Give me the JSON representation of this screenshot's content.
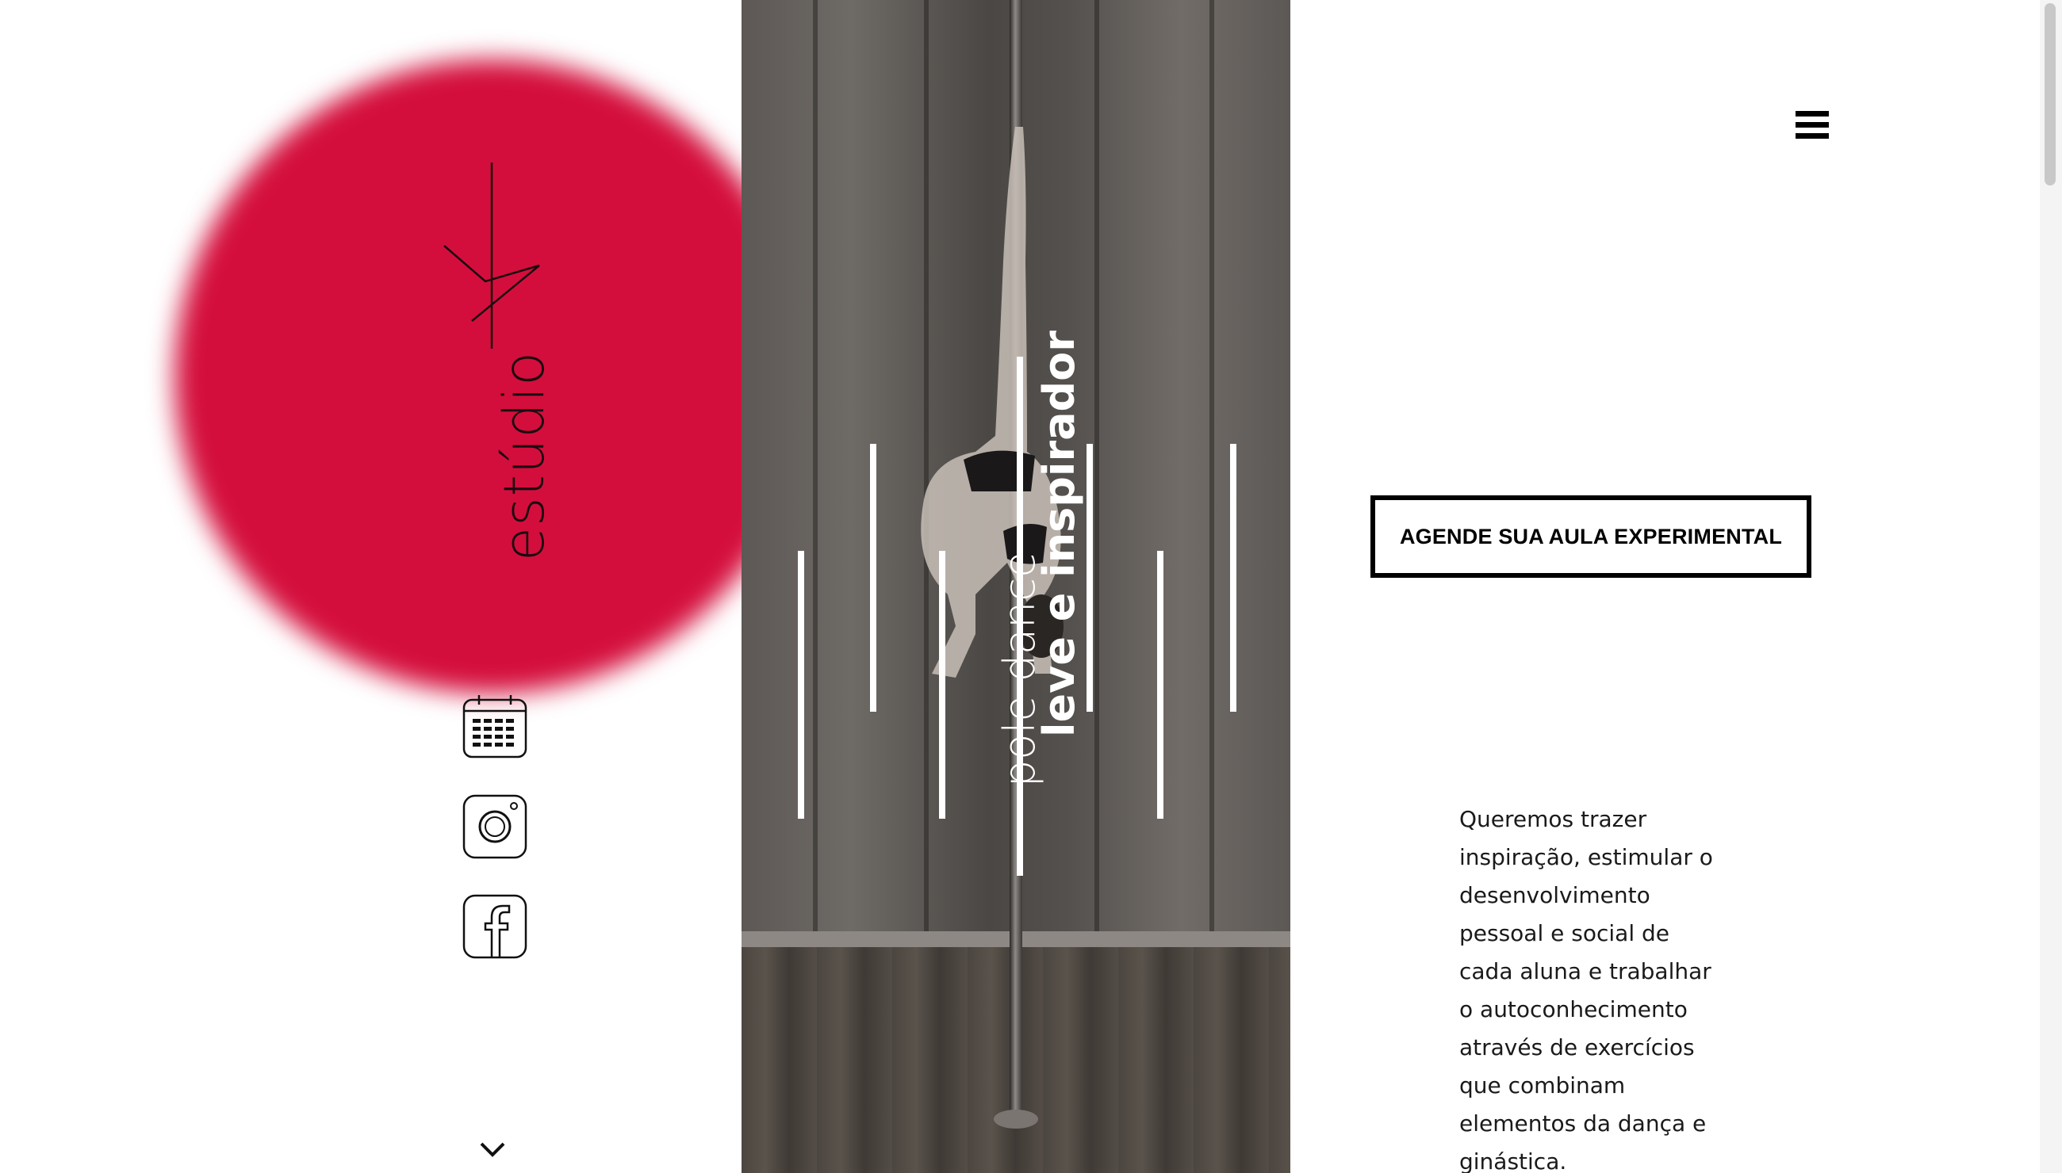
{
  "brand": {
    "logo_text": "estúdio",
    "accent_color": "#d40e3c"
  },
  "hero": {
    "tagline_light": "pole dance",
    "tagline_bold": "leve e inspirador"
  },
  "side_icons": [
    {
      "name": "calendar-icon"
    },
    {
      "name": "instagram-icon"
    },
    {
      "name": "facebook-icon"
    }
  ],
  "nav": {
    "menu_icon": "hamburger-menu-icon"
  },
  "cta": {
    "label": "AGENDE SUA AULA EXPERIMENTAL"
  },
  "about": {
    "text": "Queremos trazer inspiração, estimular o desenvolvimento pessoal e social de cada aluna e trabalhar o autoconhecimento através de exercícios que combinam elementos da dança e ginástica."
  }
}
